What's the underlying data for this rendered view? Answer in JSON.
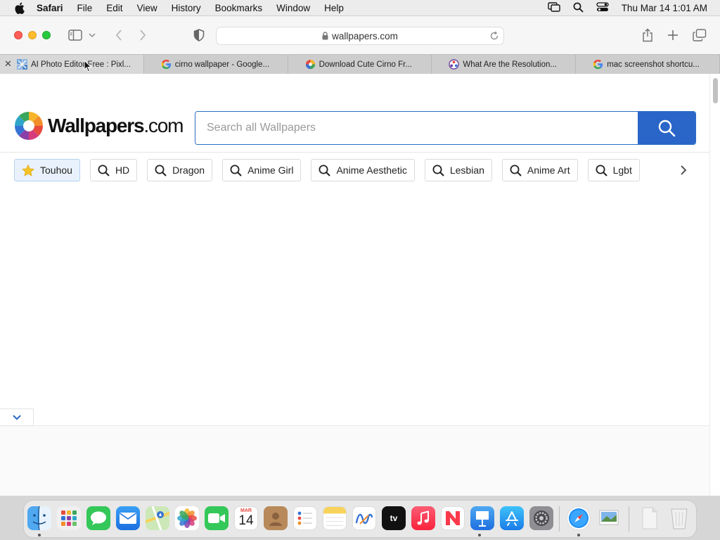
{
  "menubar": {
    "app_name": "Safari",
    "items": [
      "File",
      "Edit",
      "View",
      "History",
      "Bookmarks",
      "Window",
      "Help"
    ],
    "clock": "Thu Mar 14  1:01 AM"
  },
  "browser": {
    "url": "wallpapers.com",
    "tabs": [
      {
        "label": "AI Photo Editor Free : Pixl...",
        "favicon": "pixlr-icon"
      },
      {
        "label": "cirno wallpaper - Google...",
        "favicon": "google-icon"
      },
      {
        "label": "Download Cute Cirno Fr...",
        "favicon": "wallpapers-icon"
      },
      {
        "label": "What Are the Resolution...",
        "favicon": "site-icon"
      },
      {
        "label": "mac screenshot shortcu...",
        "favicon": "google-icon"
      }
    ]
  },
  "site": {
    "logo_brand": "Wallpapers",
    "logo_suffix": ".com",
    "search_placeholder": "Search all Wallpapers",
    "chips": [
      {
        "label": "Touhou",
        "icon": "star-icon"
      },
      {
        "label": "HD",
        "icon": "search-icon"
      },
      {
        "label": "Dragon",
        "icon": "search-icon"
      },
      {
        "label": "Anime Girl",
        "icon": "search-icon"
      },
      {
        "label": "Anime Aesthetic",
        "icon": "search-icon"
      },
      {
        "label": "Lesbian",
        "icon": "search-icon"
      },
      {
        "label": "Anime Art",
        "icon": "search-icon"
      },
      {
        "label": "Lgbt",
        "icon": "search-icon"
      }
    ]
  },
  "dock": {
    "calendar_month": "MAR",
    "calendar_day": "14",
    "apps": [
      "Finder",
      "Launchpad",
      "Messages",
      "Mail",
      "Maps",
      "Photos",
      "FaceTime",
      "Calendar",
      "Contacts",
      "Reminders",
      "Notes",
      "Freeform",
      "TV",
      "Music",
      "News",
      "Keynote",
      "App Store",
      "System Settings",
      "Safari",
      "Preview",
      "Documents",
      "Trash"
    ]
  },
  "colors": {
    "accent": "#2a66c8",
    "chip_active_bg": "#e9f2fc"
  }
}
